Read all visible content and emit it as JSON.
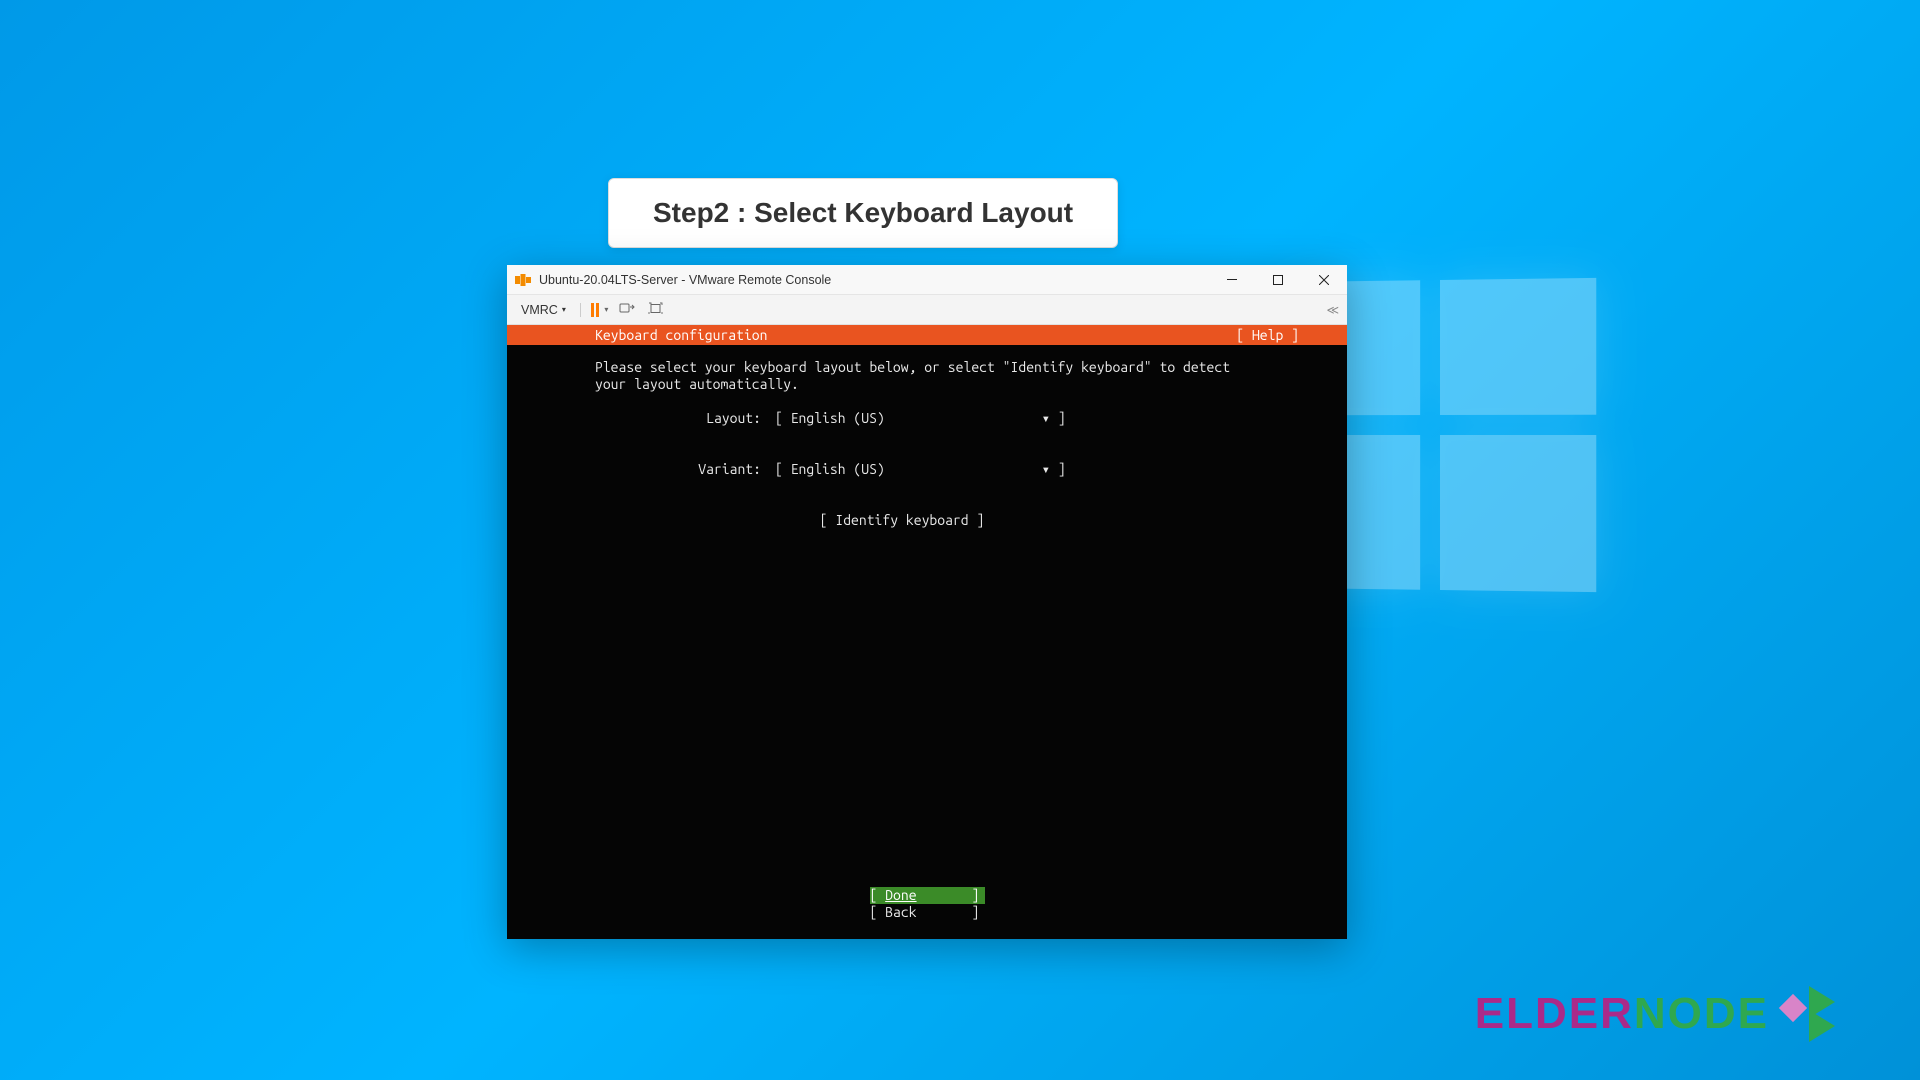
{
  "step": {
    "label": "Step2 : Select Keyboard Layout"
  },
  "window": {
    "title": "Ubuntu-20.04LTS-Server - VMware Remote Console",
    "vmrc_label": "VMRC"
  },
  "header": {
    "title": "Keyboard configuration",
    "help": "[ Help ]"
  },
  "instructions": "Please select your keyboard layout below, or select \"Identify keyboard\" to detect your layout automatically.",
  "fields": {
    "layout_label": "Layout:",
    "layout_value": "English (US)",
    "variant_label": "Variant:",
    "variant_value": "English (US)"
  },
  "identify_button": "[ Identify keyboard ]",
  "footer": {
    "done": "Done",
    "back": "Back"
  },
  "watermark": {
    "part1": "ELDER",
    "part2": "NODE"
  }
}
